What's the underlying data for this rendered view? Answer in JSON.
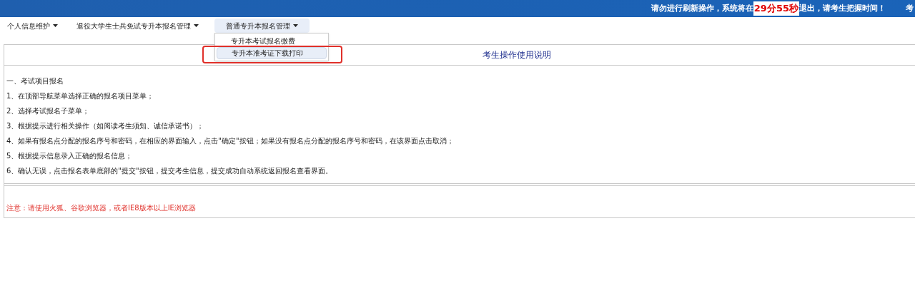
{
  "header": {
    "notice_before": "请勿进行刷新操作，系统将在",
    "countdown": "29分55秒",
    "notice_after": "退出，请考生把握时间！",
    "edge_text": "考"
  },
  "nav": [
    {
      "label": "个人信息维护",
      "selected": false
    },
    {
      "label": "退役大学生士兵免试专升本报名管理",
      "selected": false
    },
    {
      "label": "普通专升本报名管理",
      "selected": true,
      "expanded": true,
      "menu": [
        {
          "label": "专升本考试报名缴费",
          "selected": false
        },
        {
          "label": "专升本准考证下载打印",
          "selected": true,
          "annotated": true
        }
      ]
    }
  ],
  "panel": {
    "title": "考生操作使用说明",
    "section": "一、考试项目报名",
    "steps": [
      "1、在顶部导航菜单选择正确的报名项目菜单；",
      "2、选择考试报名子菜单；",
      "3、根据提示进行相关操作（如阅读考生须知、诚信承诺书）；",
      "4、如果有报名点分配的报名序号和密码，在相应的界面输入，点击\"确定\"按钮；如果没有报名点分配的报名序号和密码，在该界面点击取消；",
      "5、根据提示信息录入正确的报名信息；",
      "6、确认无误，点击报名表单底部的\"提交\"按钮，提交考生信息，提交成功自动系统返回报名查看界面。"
    ],
    "note": "注意：请使用火狐、谷歌浏览器，或者IE8版本以上IE浏览器"
  }
}
